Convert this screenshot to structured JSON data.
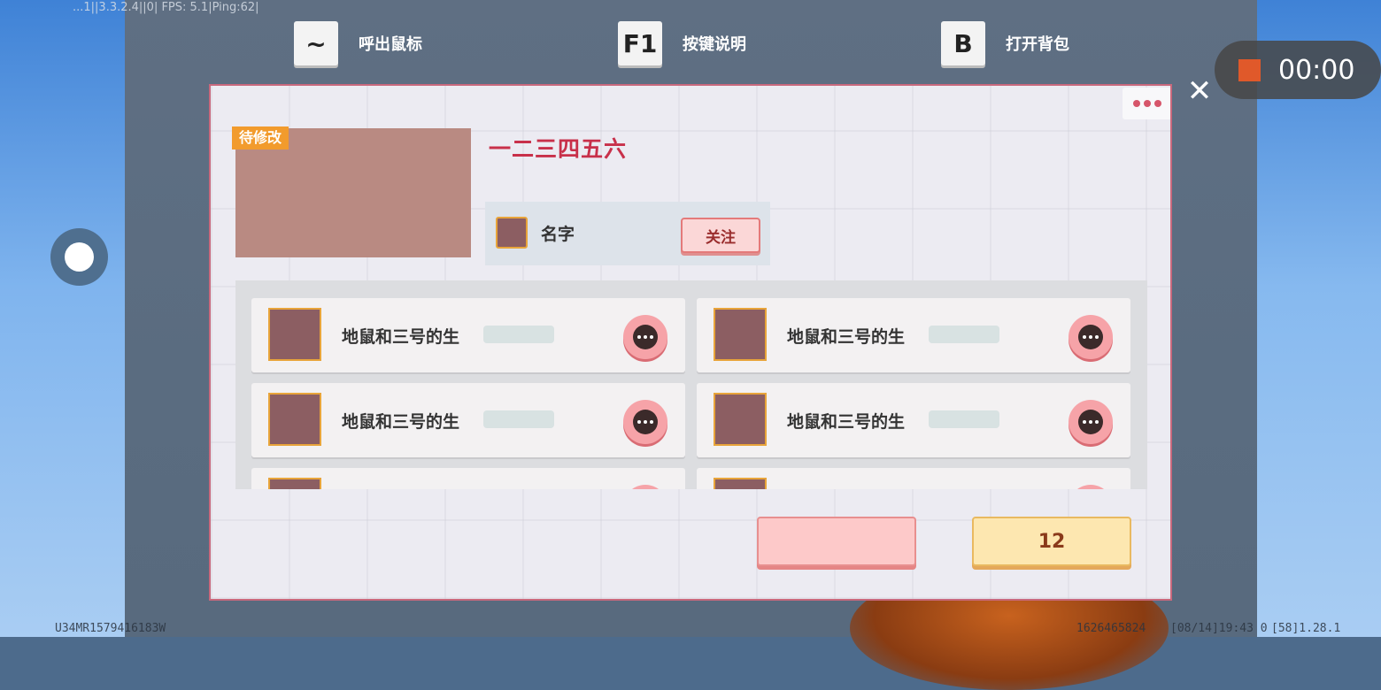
{
  "debug_text": "...1||3.3.2.4||0| FPS: 5.1|Ping:62|",
  "key_hints": [
    {
      "key": "~",
      "label": "呼出鼠标"
    },
    {
      "key": "F1",
      "label": "按键说明"
    },
    {
      "key": "B",
      "label": "打开背包"
    }
  ],
  "recorder": {
    "time": "00:00",
    "color": "#e0592a"
  },
  "close_label": "✕",
  "dialog": {
    "tag": "待修改",
    "title": "一二三四五六",
    "owner_name": "名字",
    "follow_label": "关注",
    "list": [
      {
        "name": "地鼠和三号的生"
      },
      {
        "name": "地鼠和三号的生"
      },
      {
        "name": "地鼠和三号的生"
      },
      {
        "name": "地鼠和三号的生"
      },
      {
        "name": ""
      },
      {
        "name": ""
      }
    ],
    "cancel_label": "",
    "confirm_label": "12"
  },
  "footer": {
    "left": "U34MR1579416183W",
    "id": "1626465824",
    "date": "[08/14]19:43 0",
    "version": "[58]1.28.1"
  },
  "colors": {
    "accent": "#c8304a",
    "tag": "#f29b2d",
    "confirm": "#fde7b0",
    "cancel": "#fdc9c9"
  }
}
